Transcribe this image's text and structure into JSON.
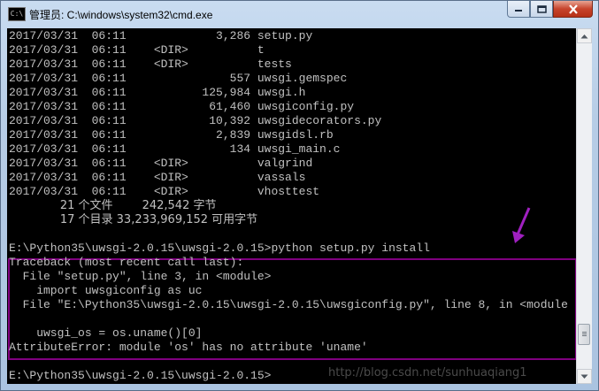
{
  "window": {
    "title": "管理员: C:\\windows\\system32\\cmd.exe",
    "icon": "cmd-icon",
    "icon_text": "C:\\"
  },
  "console": {
    "lines": [
      "2017/03/31  06:11             3,286 setup.py",
      "2017/03/31  06:11    <DIR>          t",
      "2017/03/31  06:11    <DIR>          tests",
      "2017/03/31  06:11               557 uwsgi.gemspec",
      "2017/03/31  06:11           125,984 uwsgi.h",
      "2017/03/31  06:11            61,460 uwsgiconfig.py",
      "2017/03/31  06:11            10,392 uwsgidecorators.py",
      "2017/03/31  06:11             2,839 uwsgidsl.rb",
      "2017/03/31  06:11               134 uwsgi_main.c",
      "2017/03/31  06:11    <DIR>          valgrind",
      "2017/03/31  06:11    <DIR>          vassals",
      "2017/03/31  06:11    <DIR>          vhosttest",
      "              21 个文件        242,542 字节",
      "              17 个目录 33,233,969,152 可用字节",
      "",
      "E:\\Python35\\uwsgi-2.0.15\\uwsgi-2.0.15>python setup.py install",
      "Traceback (most recent call last):",
      "  File \"setup.py\", line 3, in <module>",
      "    import uwsgiconfig as uc",
      "  File \"E:\\Python35\\uwsgi-2.0.15\\uwsgi-2.0.15\\uwsgiconfig.py\", line 8, in <module",
      "",
      "    uwsgi_os = os.uname()[0]",
      "AttributeError: module 'os' has no attribute 'uname'",
      "",
      "E:\\Python35\\uwsgi-2.0.15\\uwsgi-2.0.15>"
    ]
  },
  "watermark": "http://blog.csdn.net/sunhuaqiang1",
  "annotation": {
    "arrow_color": "#a020c0",
    "box_color": "#800080"
  },
  "colors": {
    "console_bg": "#000000",
    "console_text": "#c0c0c0"
  }
}
